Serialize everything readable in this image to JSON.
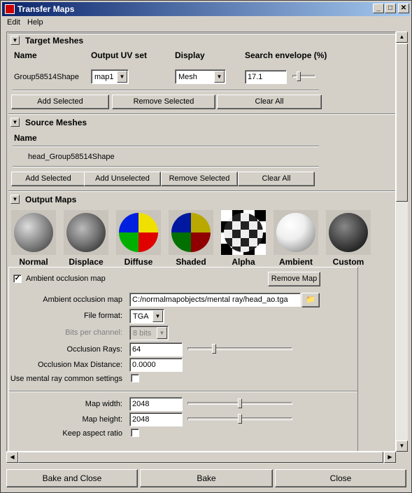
{
  "window": {
    "title": "Transfer Maps",
    "controls": {
      "minimize": "_",
      "maximize": "□",
      "close": "✕"
    }
  },
  "menu": {
    "edit": "Edit",
    "help": "Help"
  },
  "target_meshes": {
    "header": "Target Meshes",
    "columns": {
      "name": "Name",
      "uv_set": "Output UV set",
      "display": "Display",
      "envelope": "Search envelope (%)"
    },
    "row": {
      "name": "Group58514Shape",
      "uv_set": "map1",
      "display": "Mesh",
      "envelope": "17.1"
    },
    "buttons": {
      "add_selected": "Add Selected",
      "remove_selected": "Remove Selected",
      "clear_all": "Clear All"
    }
  },
  "source_meshes": {
    "header": "Source Meshes",
    "column_name": "Name",
    "item": "head_Group58514Shape",
    "buttons": {
      "add_selected": "Add Selected",
      "add_unselected": "Add Unselected",
      "remove_selected": "Remove Selected",
      "clear_all": "Clear All"
    }
  },
  "output_maps": {
    "header": "Output Maps",
    "maps": [
      {
        "label": "Normal",
        "icon": "normal-map-icon"
      },
      {
        "label": "Displace",
        "icon": "displace-map-icon"
      },
      {
        "label": "Diffuse",
        "icon": "diffuse-map-icon"
      },
      {
        "label": "Shaded",
        "icon": "shaded-map-icon"
      },
      {
        "label": "Alpha",
        "icon": "alpha-map-icon"
      },
      {
        "label": "Ambient",
        "icon": "ambient-map-icon"
      },
      {
        "label": "Custom",
        "icon": "custom-map-icon"
      }
    ]
  },
  "ao": {
    "enabled_label": "Ambient occlusion map",
    "enabled": true,
    "remove_button": "Remove Map",
    "map_label": "Ambient occlusion map",
    "map_path": "C:/normalmapobjects/mental ray/head_ao.tga",
    "file_format_label": "File format:",
    "file_format": "TGA",
    "bits_label": "Bits per channel:",
    "bits": "8 bits",
    "rays_label": "Occlusion Rays:",
    "rays": "64",
    "max_dist_label": "Occlusion Max Distance:",
    "max_dist": "0.0000",
    "common_label": "Use mental ray common settings",
    "common_checked": false,
    "width_label": "Map width:",
    "width": "2048",
    "height_label": "Map height:",
    "height": "2048",
    "aspect_label": "Keep aspect ratio",
    "aspect_checked": false
  },
  "footer": {
    "bake_close": "Bake and Close",
    "bake": "Bake",
    "close": "Close"
  }
}
